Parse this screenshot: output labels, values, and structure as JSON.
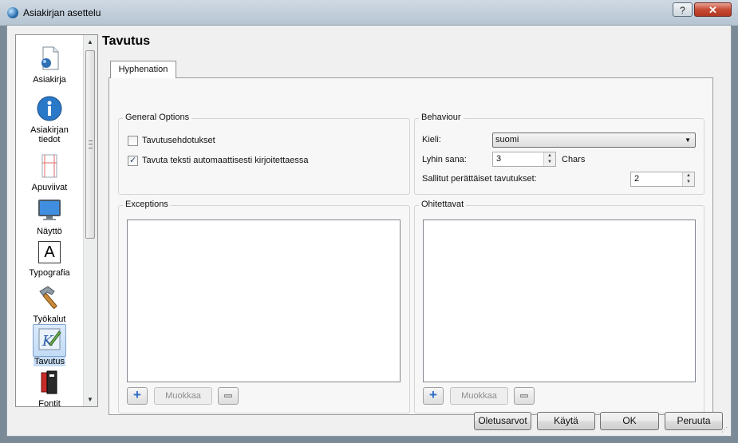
{
  "window": {
    "title": "Asiakirjan asettelu",
    "help_label": "?",
    "close_label": "✕"
  },
  "sidebar": {
    "items": [
      {
        "label": "Asiakirja",
        "icon": "document-icon"
      },
      {
        "label": "Asiakirjan tiedot",
        "icon": "info-icon"
      },
      {
        "label": "Apuviivat",
        "icon": "guides-icon"
      },
      {
        "label": "Näyttö",
        "icon": "monitor-icon"
      },
      {
        "label": "Typografia",
        "icon": "typography-icon",
        "glyph": "A"
      },
      {
        "label": "Työkalut",
        "icon": "hammer-icon"
      },
      {
        "label": "Tavutus",
        "icon": "hyphenation-icon",
        "selected": true
      },
      {
        "label": "Fontit",
        "icon": "fonts-icon"
      }
    ]
  },
  "page": {
    "title": "Tavutus"
  },
  "tabs": [
    {
      "label": "Hyphenation",
      "active": true
    }
  ],
  "general_options": {
    "title": "General Options",
    "suggestions_label": "Tavutusehdotukset",
    "suggestions_checked": false,
    "auto_label": "Tavuta teksti automaattisesti kirjoitettaessa",
    "auto_checked": true
  },
  "behaviour": {
    "title": "Behaviour",
    "language_label": "Kieli:",
    "language_value": "suomi",
    "shortest_word_label": "Lyhin sana:",
    "shortest_word_value": "3",
    "shortest_word_unit": "Chars",
    "consecutive_label": "Sallitut perättäiset tavutukset:",
    "consecutive_value": "2"
  },
  "exceptions": {
    "title": "Exceptions",
    "add_label": "+",
    "edit_label": "Muokkaa",
    "remove_label": "−"
  },
  "ignore": {
    "title": "Ohitettavat",
    "add_label": "+",
    "edit_label": "Muokkaa",
    "remove_label": "−"
  },
  "dialog_buttons": {
    "defaults": "Oletusarvot",
    "apply": "Käytä",
    "ok": "OK",
    "cancel": "Peruuta"
  },
  "colors": {
    "accent": "#2c6cc9",
    "selection": "#c7ddf4"
  }
}
